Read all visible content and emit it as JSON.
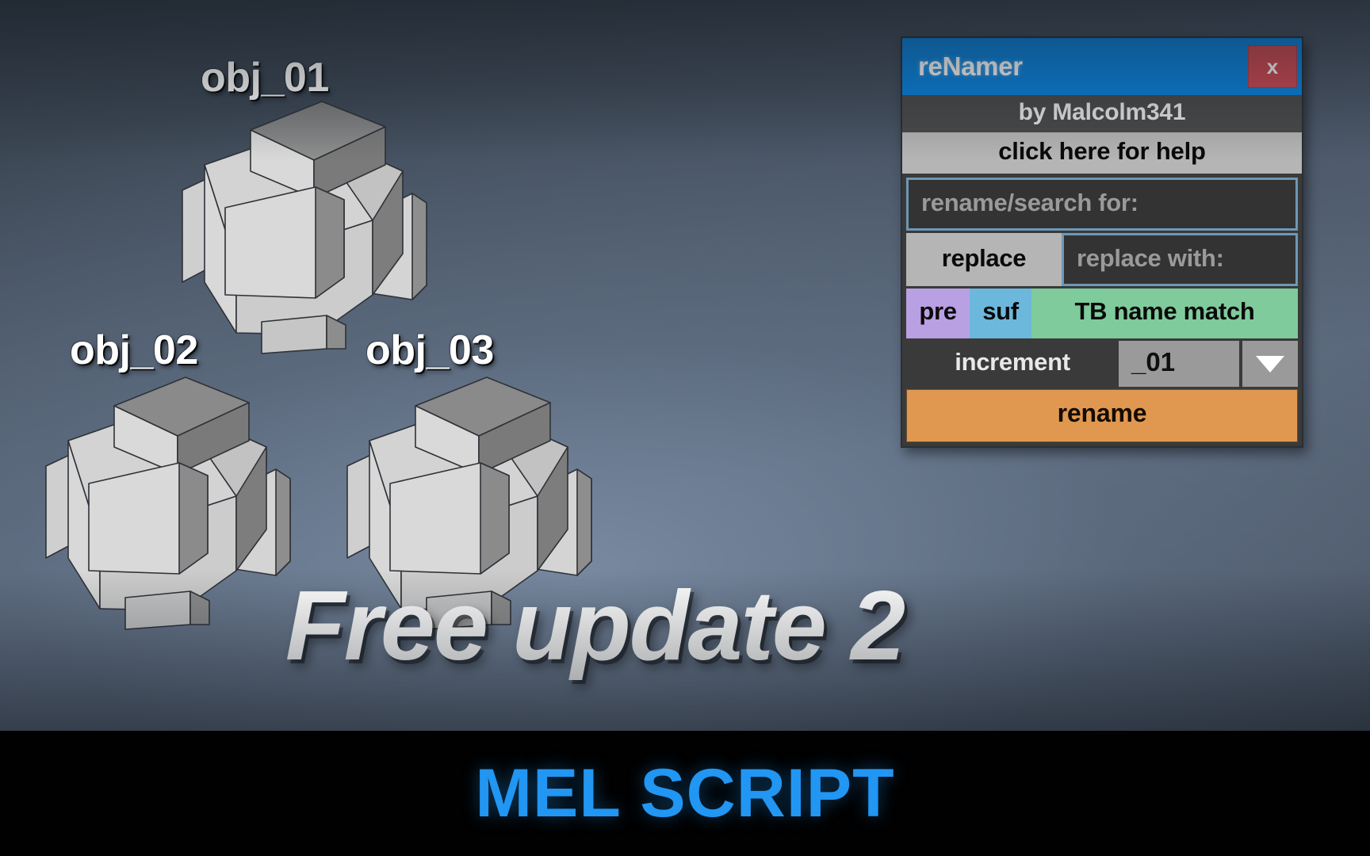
{
  "scene": {
    "objects": [
      {
        "label": "obj_01"
      },
      {
        "label": "obj_02"
      },
      {
        "label": "obj_03"
      }
    ]
  },
  "headline": {
    "text": "Free update 2"
  },
  "banner": {
    "text": "MEL SCRIPT"
  },
  "renamer": {
    "title": "reNamer",
    "close_label": "x",
    "credit": "by Malcolm341",
    "help_label": "click here for help",
    "search_placeholder": "rename/search for:",
    "replace_button_label": "replace",
    "replace_with_placeholder": "replace with:",
    "prefix_label": "pre",
    "suffix_label": "suf",
    "name_match_label": "TB name match",
    "increment_label": "increment",
    "increment_value": "_01",
    "increment_dropdown_icon": "chevron-down-icon",
    "rename_button_label": "rename"
  },
  "colors": {
    "titlebar": "#0a84e0",
    "close": "#cf4a52",
    "help": "#b5b5b5",
    "field_border": "#6e97b5",
    "prefix": "#b9a0e3",
    "suffix": "#6cb8dc",
    "name_match": "#7fcb9c",
    "rename": "#e09850",
    "banner_text": "#2196f3",
    "viewport_bg": "#4d596a"
  }
}
